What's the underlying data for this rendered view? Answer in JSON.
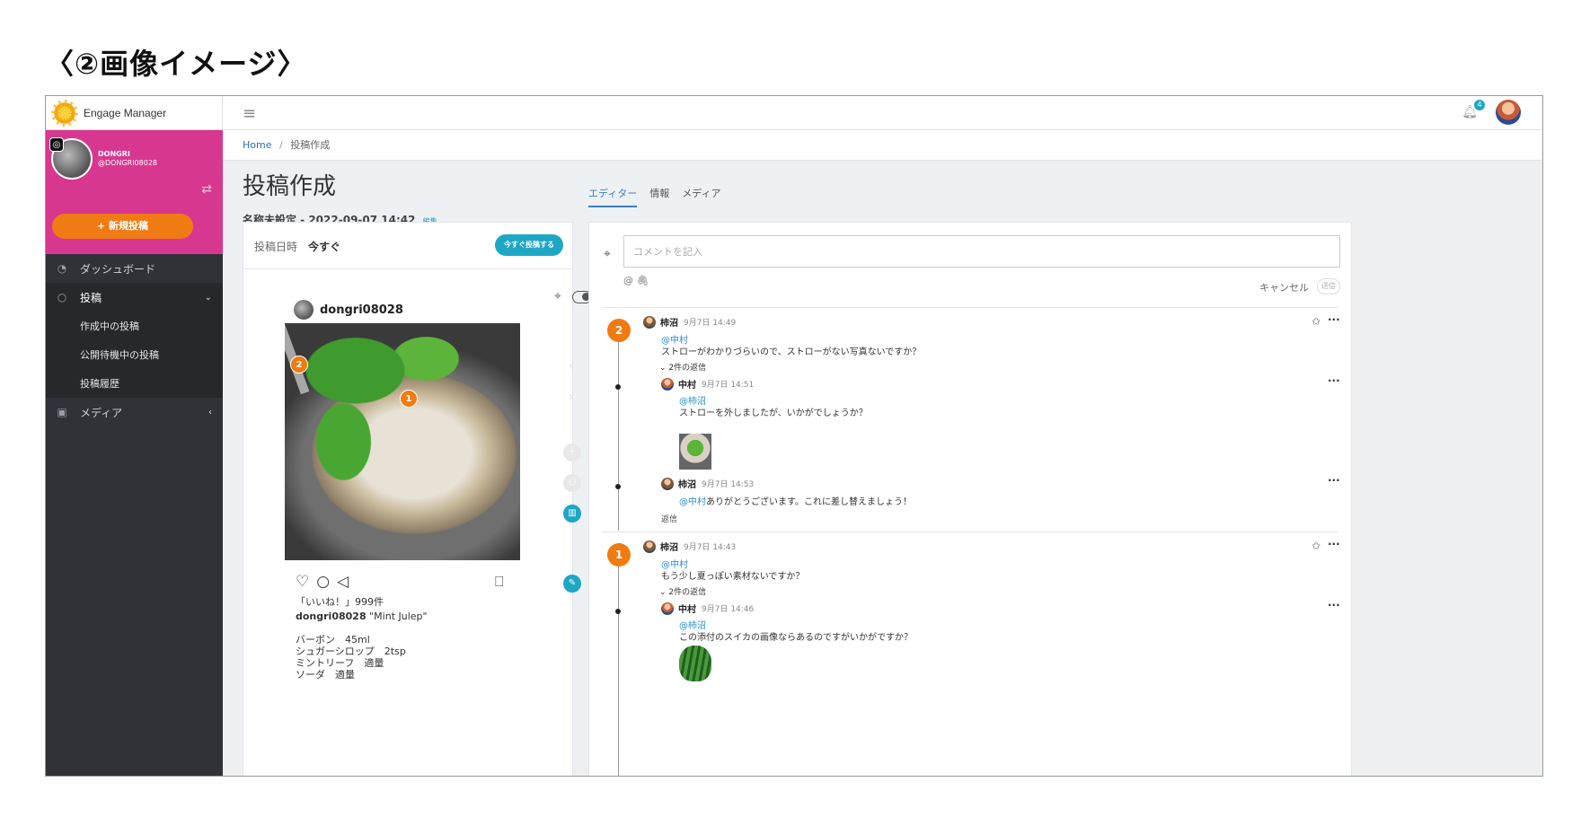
{
  "doc_title": "〈②画像イメージ〉",
  "brand": {
    "name": "Engage Manager"
  },
  "account": {
    "name": "DONGRI",
    "handle": "@DONGRI08028",
    "new_post_label": "+ 新規投稿"
  },
  "nav": {
    "dashboard": "ダッシュボード",
    "posts": "投稿",
    "sub": [
      "作成中の投稿",
      "公開待機中の投稿",
      "投稿履歴"
    ],
    "media": "メディア"
  },
  "topbar": {
    "notifications": "4"
  },
  "breadcrumb": {
    "home": "Home",
    "current": "投稿作成"
  },
  "page": {
    "title": "投稿作成",
    "subtitle": "名称未設定 - 2022-09-07 14:42",
    "edit_label": "編集"
  },
  "tabs": [
    "エディター",
    "情報",
    "メディア"
  ],
  "post": {
    "date_label": "投稿日時",
    "date_value": "今すぐ",
    "post_now_label": "今すぐ投稿する",
    "username": "dongri08028",
    "markers": [
      "1",
      "2"
    ],
    "likes": "「いいね！」999件",
    "caption_user": "dongri08028",
    "caption_text": "\"Mint Julep\"",
    "body_lines": [
      "バーボン　45ml",
      "シュガーシロップ　2tsp",
      "ミントリーフ　適量",
      "ソーダ　適量"
    ]
  },
  "comments": {
    "input_placeholder": "コメントを記入",
    "tools": "@ 🖇",
    "cancel_label": "キャンセル",
    "send_label": "送信",
    "threads": [
      {
        "number": "2",
        "author": "柿沼",
        "time": "9月7日 14:49",
        "mention": "@中村",
        "text": "ストローがわかりづらいので、ストローがない写真ないですか？",
        "replies_label": "2件の返信",
        "replies": [
          {
            "author": "中村",
            "time": "9月7日 14:51",
            "mention": "@柿沼",
            "text": "ストローを外しましたが、いかがでしょうか？"
          },
          {
            "author": "柿沼",
            "time": "9月7日 14:53",
            "mention": "@中村",
            "text": "ありがとうございます。これに差し替えましょう！"
          }
        ],
        "reply_action": "返信"
      },
      {
        "number": "1",
        "author": "柿沼",
        "time": "9月7日 14:43",
        "mention": "@中村",
        "text": "もう少し夏っぽい素材ないですか？",
        "replies_label": "2件の返信",
        "replies": [
          {
            "author": "中村",
            "time": "9月7日 14:46",
            "mention": "@柿沼",
            "text": "この添付のスイカの画像ならあるのですがいかがですか？"
          }
        ]
      }
    ]
  }
}
